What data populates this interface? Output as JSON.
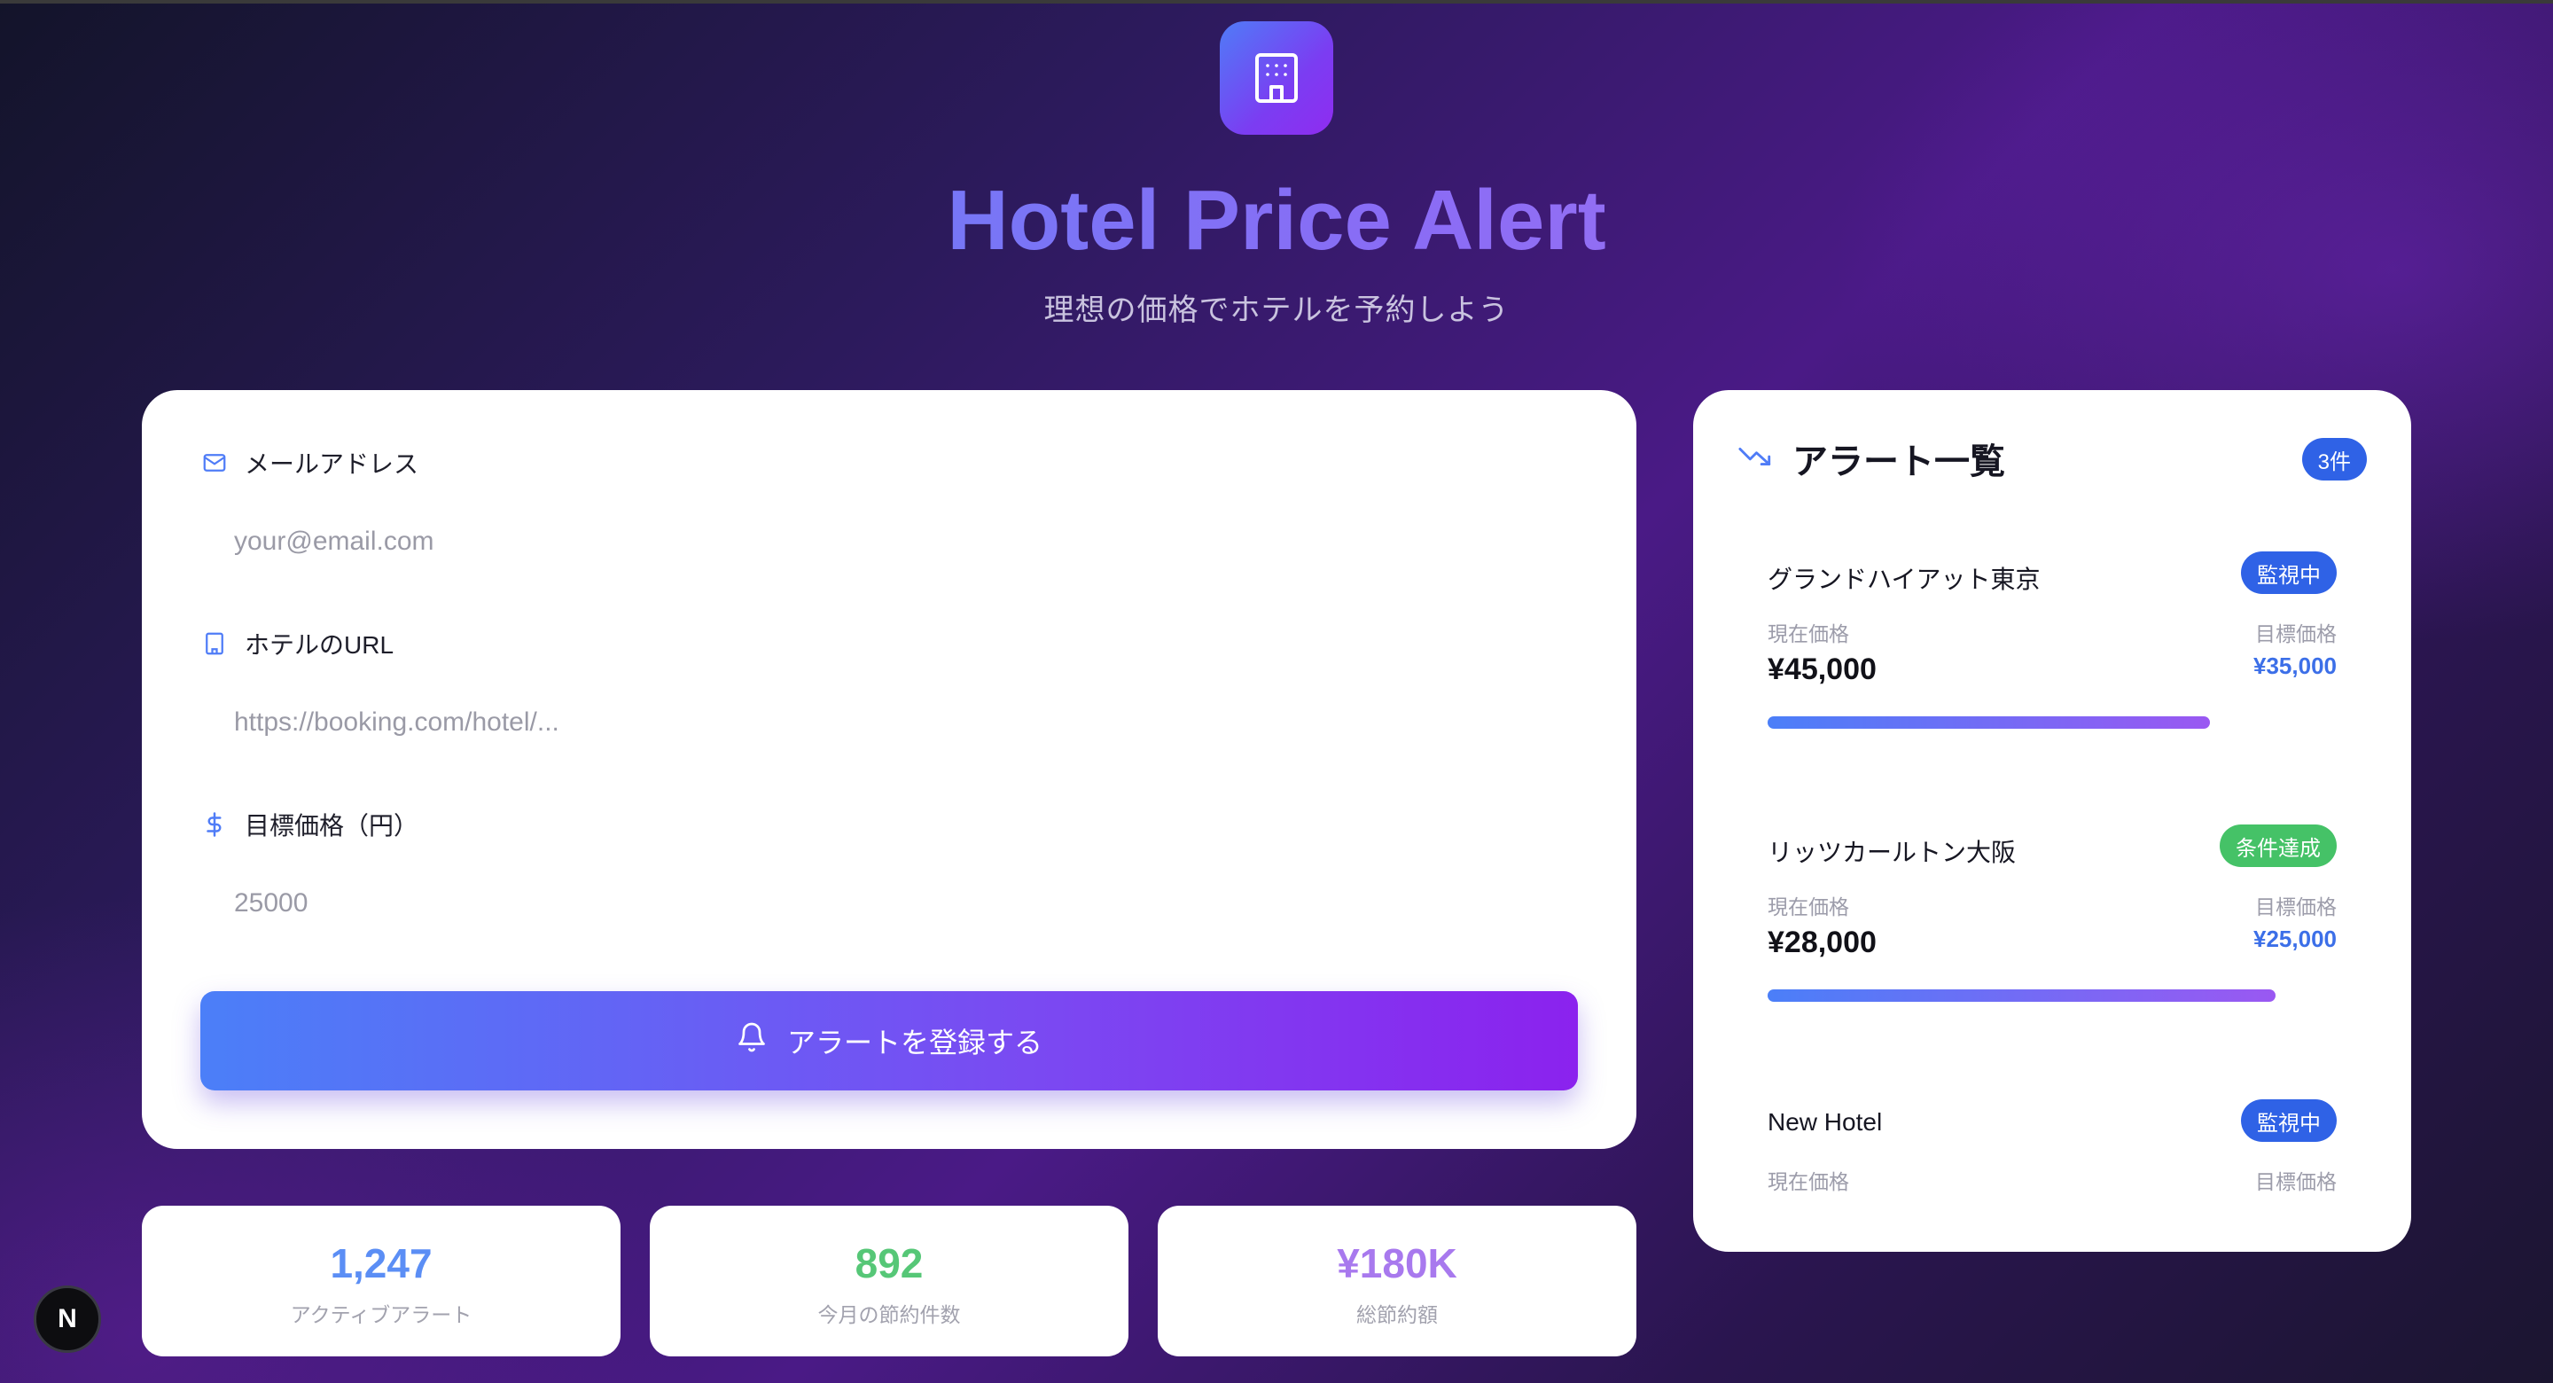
{
  "header": {
    "title": "Hotel Price Alert",
    "subtitle": "理想の価格でホテルを予約しよう"
  },
  "form": {
    "email_label": "メールアドレス",
    "email_placeholder": "your@email.com",
    "url_label": "ホテルのURL",
    "url_placeholder": "https://booking.com/hotel/...",
    "price_label": "目標価格（円）",
    "price_placeholder": "25000",
    "submit_label": "アラートを登録する"
  },
  "stats": [
    {
      "value": "1,247",
      "label": "アクティブアラート",
      "color": "#5b8ef5"
    },
    {
      "value": "892",
      "label": "今月の節約件数",
      "color": "#56c777"
    },
    {
      "value": "¥180K",
      "label": "総節約額",
      "color": "#a879ee"
    }
  ],
  "alerts": {
    "title": "アラート一覧",
    "count": "3件",
    "items": [
      {
        "name": "グランドハイアット東京",
        "status": "監視中",
        "status_color": "#2f62e6",
        "current_label": "現在価格",
        "target_label": "目標価格",
        "current_price": "¥45,000",
        "target_price": "¥35,000",
        "progress": 0.778
      },
      {
        "name": "リッツカールトン大阪",
        "status": "条件達成",
        "status_color": "#45c267",
        "current_label": "現在価格",
        "target_label": "目標価格",
        "current_price": "¥28,000",
        "target_price": "¥25,000",
        "progress": 0.893
      },
      {
        "name": "New Hotel",
        "status": "監視中",
        "status_color": "#2f62e6",
        "current_label": "現在価格",
        "target_label": "目標価格"
      }
    ]
  },
  "dev_badge": "N"
}
